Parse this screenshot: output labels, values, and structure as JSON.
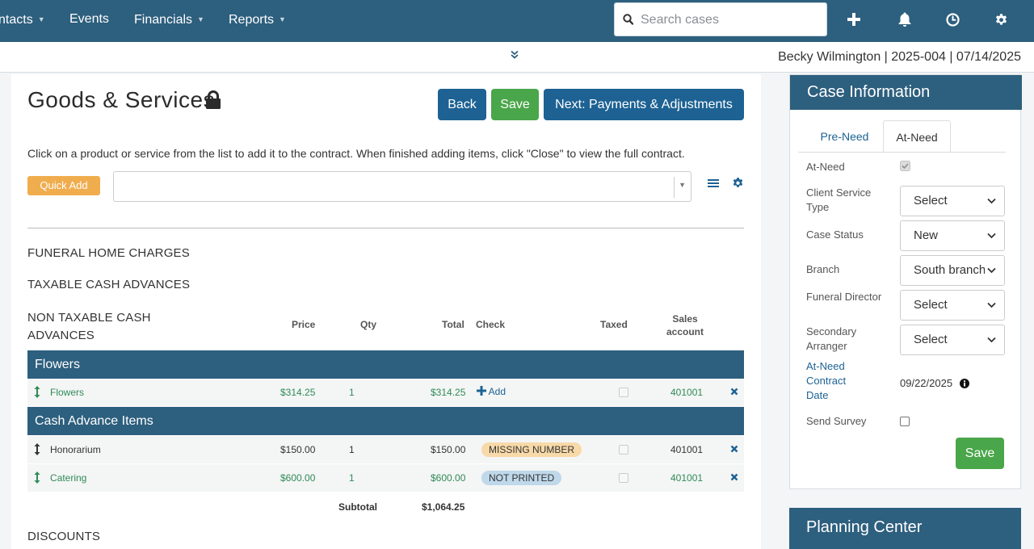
{
  "nav": {
    "items": [
      {
        "label": "ntacts",
        "has_caret": true
      },
      {
        "label": "Events",
        "has_caret": false
      },
      {
        "label": "Financials",
        "has_caret": true
      },
      {
        "label": "Reports",
        "has_caret": true
      }
    ],
    "search_placeholder": "Search cases",
    "icons": [
      "plus-icon",
      "bell-icon",
      "clock-icon",
      "gear-icon"
    ]
  },
  "subheader": {
    "case_identity": "Becky Wilmington | 2025-004 | 07/14/2025"
  },
  "main": {
    "title": "Goods & Services",
    "buttons": {
      "back": "Back",
      "save": "Save",
      "next": "Next: Payments & Adjustments"
    },
    "instructions": "Click on a product or service from the list to add it to the contract. When finished adding items, click \"Close\" to view the full contract.",
    "quick_add": "Quick Add",
    "sections": {
      "funeral_home": "FUNERAL HOME CHARGES",
      "taxable": "TAXABLE CASH ADVANCES",
      "non_taxable_line1": "NON TAXABLE CASH",
      "non_taxable_line2": "ADVANCES",
      "discounts": "DISCOUNTS"
    },
    "columns": {
      "price": "Price",
      "qty": "Qty",
      "total": "Total",
      "check": "Check",
      "taxed": "Taxed",
      "sales_line1": "Sales",
      "sales_line2": "account"
    },
    "groups": [
      {
        "name": "Flowers",
        "rows": [
          {
            "name": "Flowers",
            "price": "$314.25",
            "qty": "1",
            "total": "$314.25",
            "check": "Add",
            "taxed": false,
            "account": "401001"
          }
        ]
      },
      {
        "name": "Cash Advance Items",
        "rows": [
          {
            "name": "Honorarium",
            "price": "$150.00",
            "qty": "1",
            "total": "$150.00",
            "check": "MISSING NUMBER",
            "taxed": false,
            "account": "401001"
          },
          {
            "name": "Catering",
            "price": "$600.00",
            "qty": "1",
            "total": "$600.00",
            "check": "NOT PRINTED",
            "taxed": false,
            "account": "401001"
          }
        ]
      }
    ],
    "subtotal_label": "Subtotal",
    "subtotal_value": "$1,064.25"
  },
  "case_info": {
    "title": "Case Information",
    "tabs": [
      "Pre-Need",
      "At-Need"
    ],
    "active_tab": "At-Need",
    "fields": {
      "at_need_label": "At-Need",
      "at_need_checked": true,
      "client_service_type_label": "Client Service Type",
      "client_service_type_value": "Select",
      "case_status_label": "Case Status",
      "case_status_value": "New",
      "branch_label": "Branch",
      "branch_value": "South branch",
      "funeral_director_label": "Funeral Director",
      "funeral_director_value": "Select",
      "secondary_arranger_label": "Secondary Arranger",
      "secondary_arranger_value": "Select",
      "contract_date_label": "At-Need Contract Date",
      "contract_date_value": "09/22/2025",
      "send_survey_label": "Send Survey",
      "send_survey_checked": false
    },
    "save": "Save"
  },
  "planning_center": {
    "title": "Planning Center"
  },
  "colors": {
    "nav_bg": "#2d5f7e",
    "primary_btn": "#1d6293",
    "success_btn": "#4aa64a",
    "warning_btn": "#f0ad4e",
    "green_text": "#2e8b57"
  }
}
